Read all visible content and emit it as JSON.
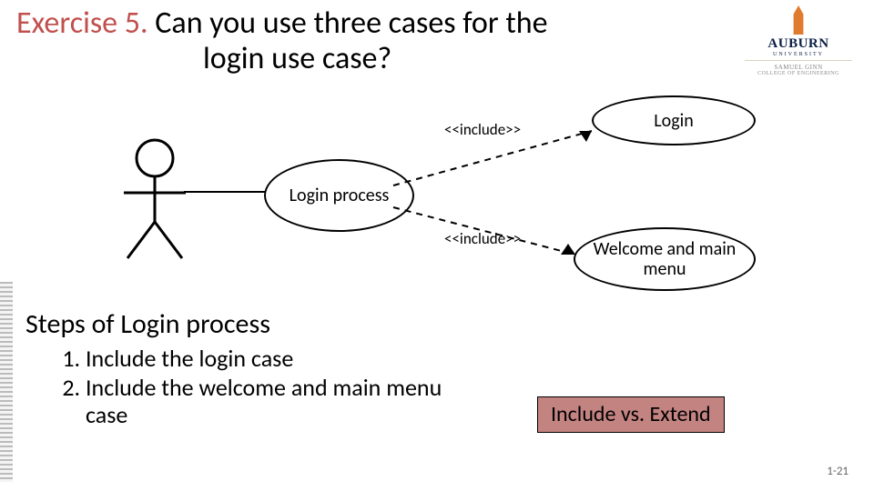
{
  "title": {
    "exercise_label": "Exercise 5.",
    "rest_line1": " Can you use three cases for the",
    "line2": "login use case?"
  },
  "logo": {
    "name": "AUBURN",
    "university": "UNIVERSITY",
    "line1": "SAMUEL GINN",
    "line2": "COLLEGE OF ENGINEERING"
  },
  "diagram": {
    "process_label": "Login process",
    "login_label": "Login",
    "welcome_label": "Welcome and main menu",
    "include_stereotype": "<<include>>"
  },
  "subhead": "Steps of Login process",
  "steps": [
    "Include the login case",
    "Include the welcome and main menu case"
  ],
  "badge_text": "Include vs. Extend",
  "slide_number": "1-21"
}
